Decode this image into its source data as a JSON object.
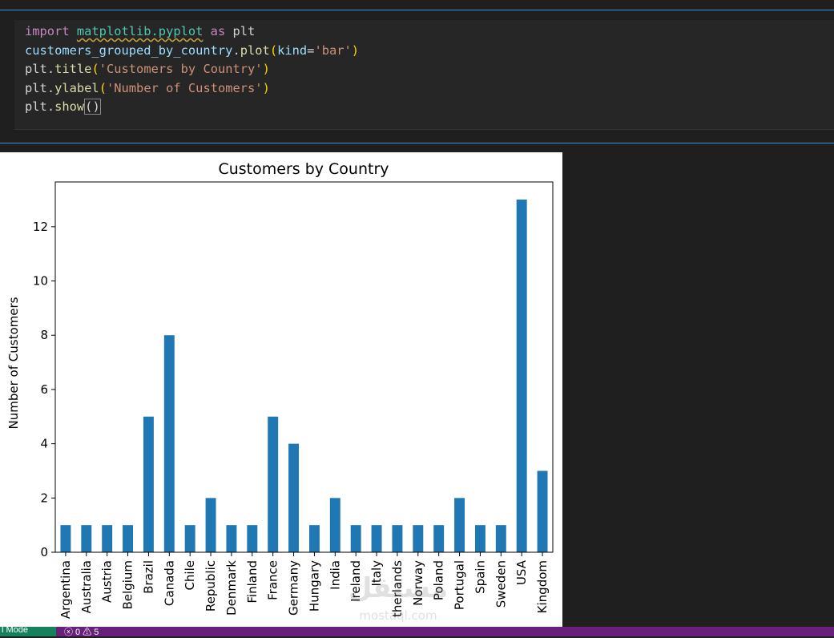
{
  "editor": {
    "code_tokens": [
      [
        {
          "t": "import ",
          "c": "kw"
        },
        {
          "t": "matplotlib.pyplot",
          "c": "mod"
        },
        {
          "t": " as ",
          "c": "kw"
        },
        {
          "t": "plt",
          "c": "plain"
        }
      ],
      [
        {
          "t": "customers_grouped_by_country",
          "c": "var"
        },
        {
          "t": ".",
          "c": "plain"
        },
        {
          "t": "plot",
          "c": "fn"
        },
        {
          "t": "(",
          "c": "p1"
        },
        {
          "t": "kind",
          "c": "var"
        },
        {
          "t": "=",
          "c": "plain"
        },
        {
          "t": "'bar'",
          "c": "str"
        },
        {
          "t": ")",
          "c": "p1"
        }
      ],
      [
        {
          "t": "plt",
          "c": "plain"
        },
        {
          "t": ".",
          "c": "plain"
        },
        {
          "t": "title",
          "c": "fn"
        },
        {
          "t": "(",
          "c": "p1"
        },
        {
          "t": "'Customers by Country'",
          "c": "str"
        },
        {
          "t": ")",
          "c": "p1"
        }
      ],
      [
        {
          "t": "plt",
          "c": "plain"
        },
        {
          "t": ".",
          "c": "plain"
        },
        {
          "t": "ylabel",
          "c": "fn"
        },
        {
          "t": "(",
          "c": "p1"
        },
        {
          "t": "'Number of Customers'",
          "c": "str"
        },
        {
          "t": ")",
          "c": "p1"
        }
      ],
      [
        {
          "t": "plt",
          "c": "plain"
        },
        {
          "t": ".",
          "c": "plain"
        },
        {
          "t": "show",
          "c": "fn"
        },
        {
          "t": "()",
          "c": "cursor"
        }
      ]
    ]
  },
  "status_bar": {
    "mode_text": "l Mode",
    "problems_text": "ⓧ 0 ⚠ 5"
  },
  "watermark": {
    "arabic": "مستقل",
    "latin": "mostaql.com"
  },
  "colors": {
    "bar": "#1f77b4",
    "accent_border": "#3794d8",
    "status_bar": "#68217a"
  },
  "chart_data": {
    "type": "bar",
    "title": "Customers by Country",
    "xlabel": "",
    "ylabel": "Number of Customers",
    "ylim": [
      0,
      13.65
    ],
    "yticks": [
      0,
      2,
      4,
      6,
      8,
      10,
      12
    ],
    "categories": [
      "Argentina",
      "Australia",
      "Austria",
      "Belgium",
      "Brazil",
      "Canada",
      "Chile",
      "Republic",
      "Denmark",
      "Finland",
      "France",
      "Germany",
      "Hungary",
      "India",
      "Ireland",
      "Italy",
      "therlands",
      "Norway",
      "Poland",
      "Portugal",
      "Spain",
      "Sweden",
      "USA",
      "Kingdom"
    ],
    "values": [
      1,
      1,
      1,
      1,
      5,
      8,
      1,
      2,
      1,
      1,
      5,
      4,
      1,
      2,
      1,
      1,
      1,
      1,
      1,
      2,
      1,
      1,
      13,
      3
    ],
    "grid": false,
    "legend": "none"
  }
}
